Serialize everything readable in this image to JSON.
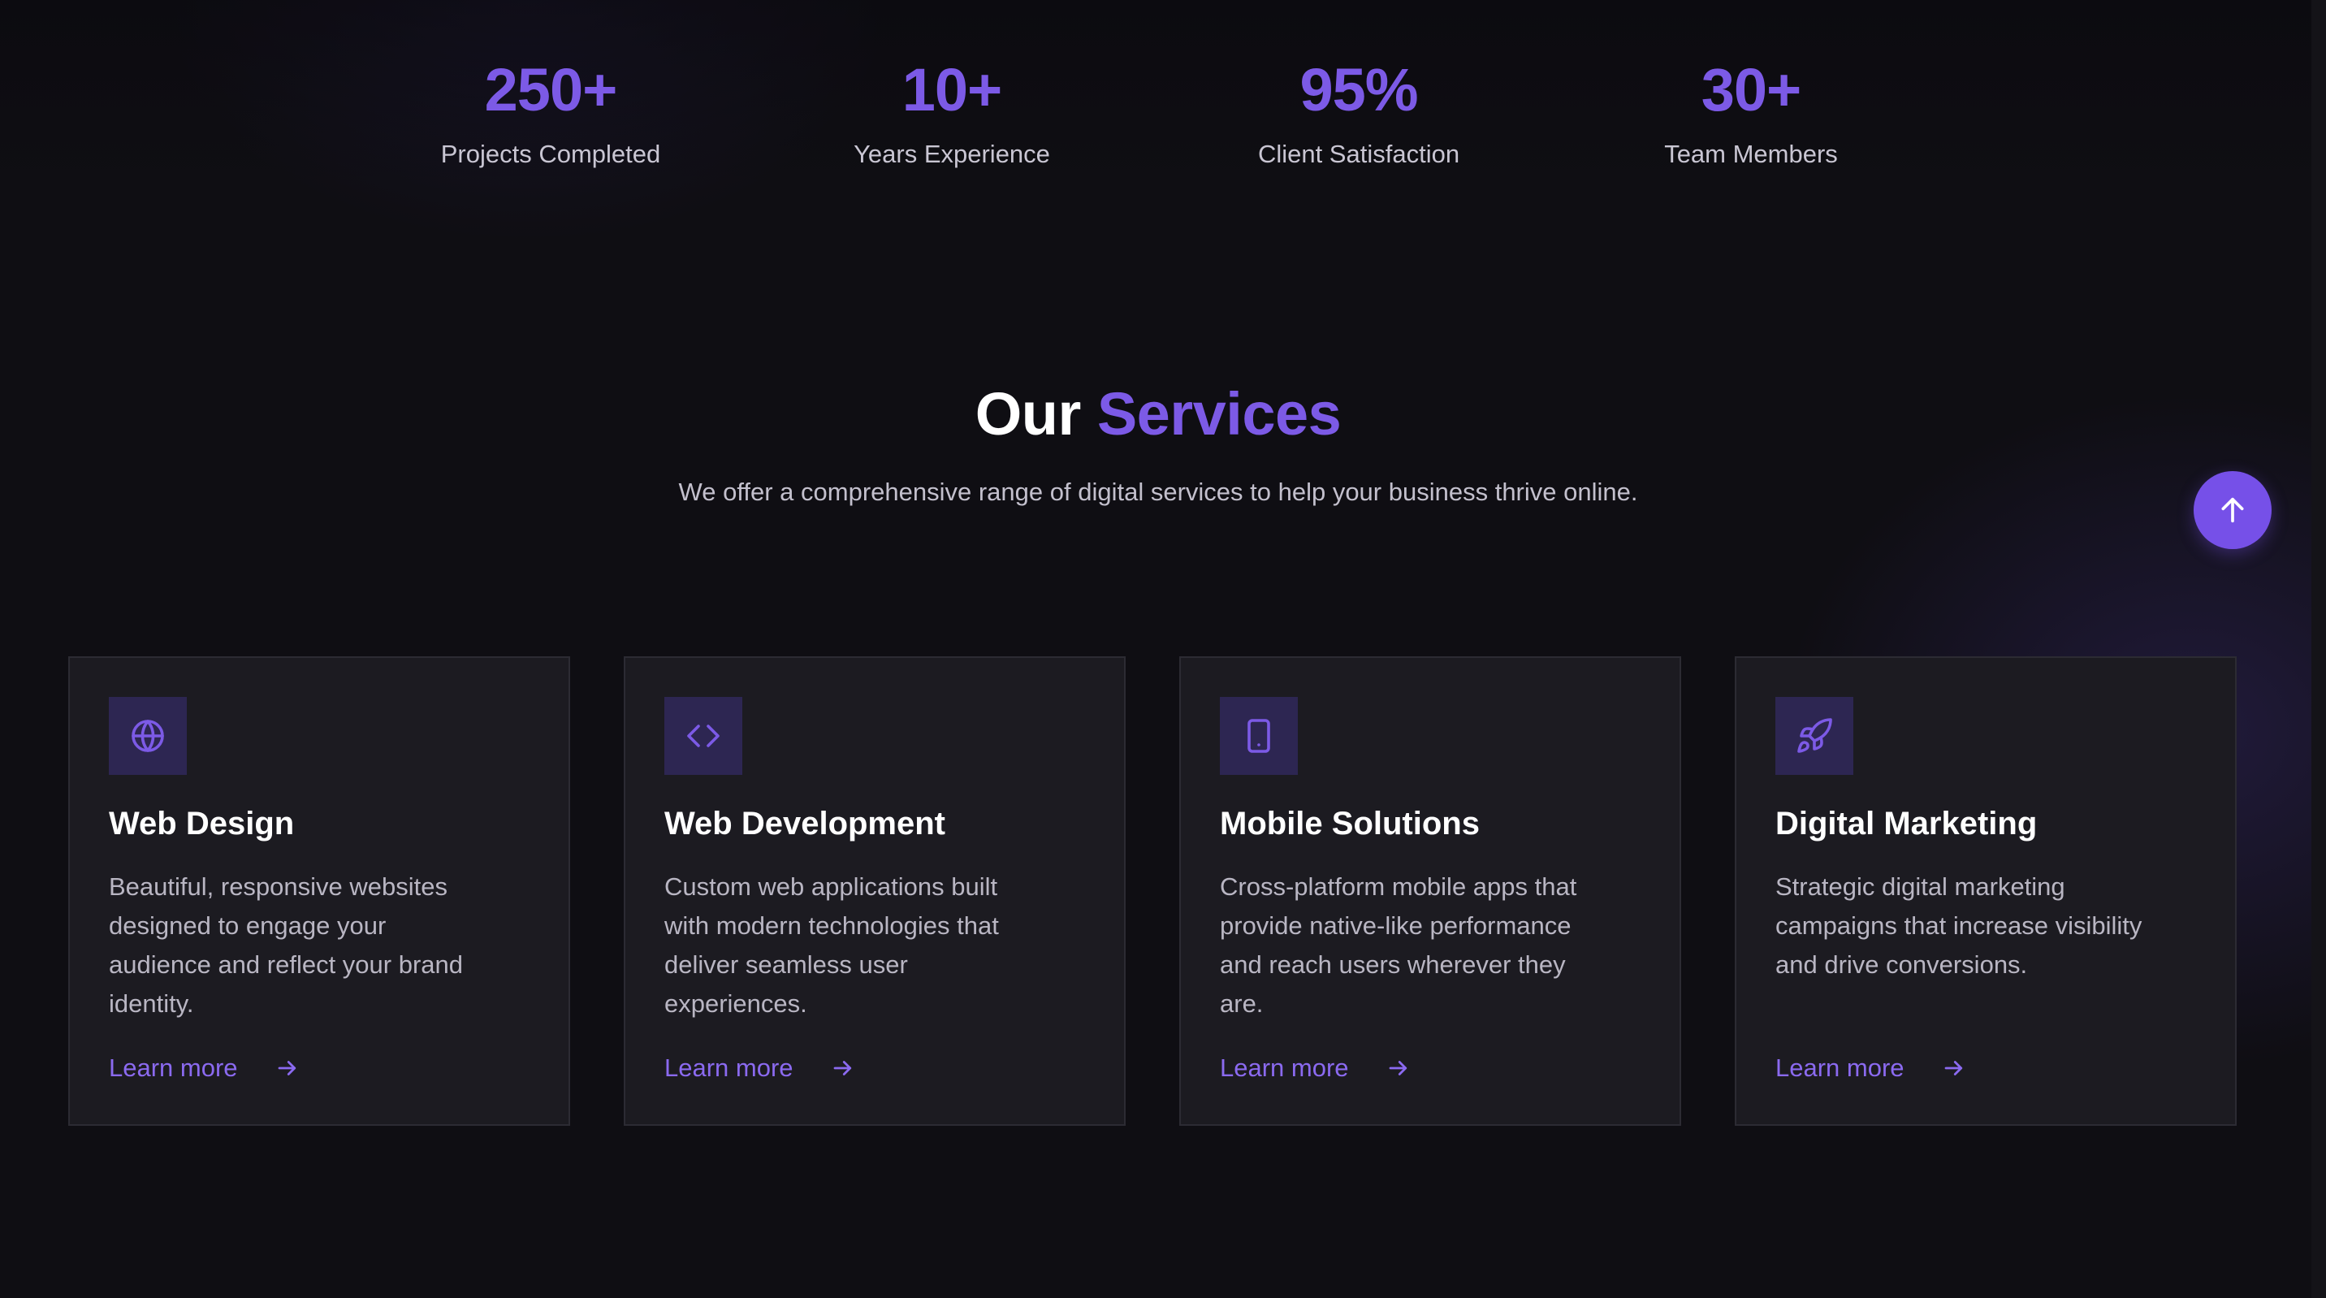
{
  "stats": [
    {
      "value": "250+",
      "label": "Projects Completed"
    },
    {
      "value": "10+",
      "label": "Years Experience"
    },
    {
      "value": "95%",
      "label": "Client Satisfaction"
    },
    {
      "value": "30+",
      "label": "Team Members"
    }
  ],
  "services": {
    "heading_white": "Our",
    "heading_accent": "Services",
    "subtitle": "We offer a comprehensive range of digital services to help your business thrive online.",
    "cards": [
      {
        "icon": "globe-icon",
        "title": "Web Design",
        "description": "Beautiful, responsive websites designed to engage your audience and reflect your brand identity.",
        "link": "Learn more"
      },
      {
        "icon": "code-icon",
        "title": "Web Development",
        "description": "Custom web applications built with modern technologies that deliver seamless user experiences.",
        "link": "Learn more"
      },
      {
        "icon": "smartphone-icon",
        "title": "Mobile Solutions",
        "description": "Cross-platform mobile apps that provide native-like performance and reach users wherever they are.",
        "link": "Learn more"
      },
      {
        "icon": "rocket-icon",
        "title": "Digital Marketing",
        "description": "Strategic digital marketing campaigns that increase visibility and drive conversions.",
        "link": "Learn more"
      }
    ]
  },
  "back_to_top": {
    "icon": "arrow-up-icon"
  },
  "colors": {
    "accent": "#7c5ae6",
    "background": "#0f0e13",
    "card": "#1c1b21",
    "icon_tile": "#2d2652"
  }
}
